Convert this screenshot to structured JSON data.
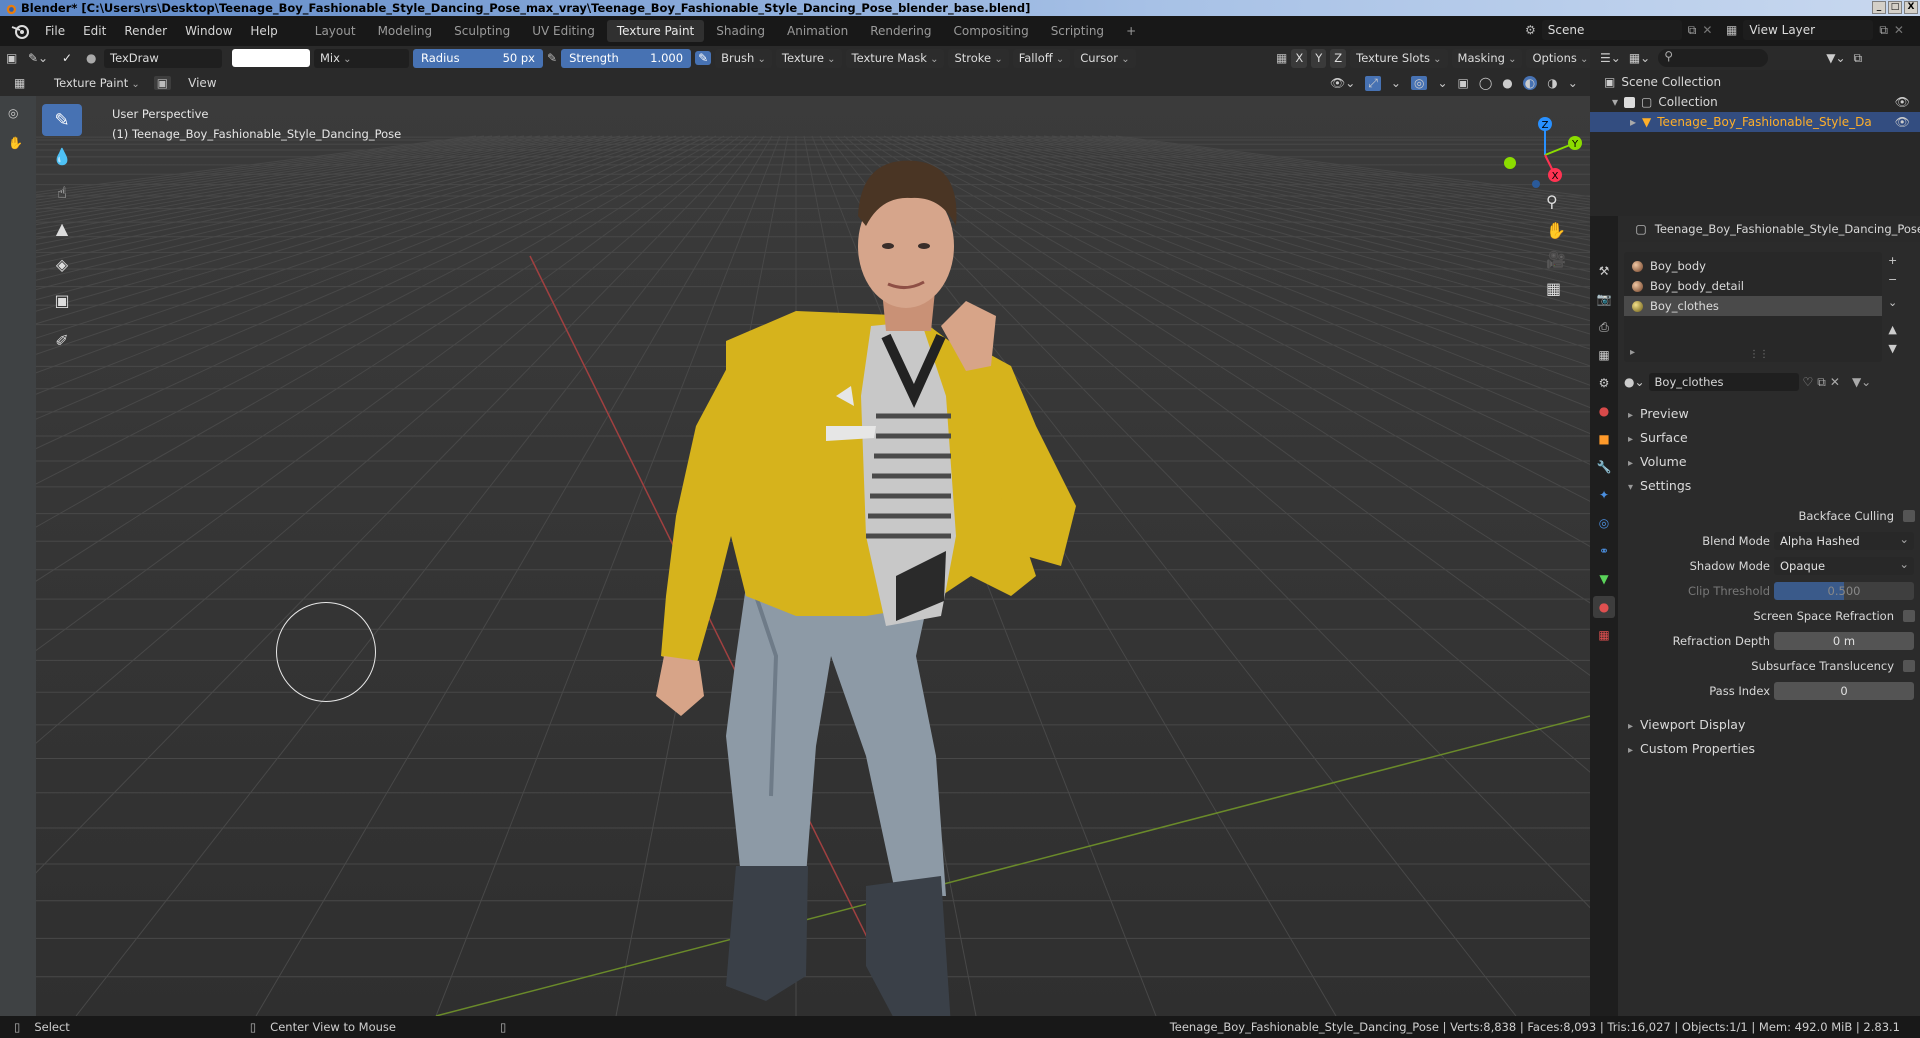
{
  "window": {
    "title": "Blender* [C:\\Users\\rs\\Desktop\\Teenage_Boy_Fashionable_Style_Dancing_Pose_max_vray\\Teenage_Boy_Fashionable_Style_Dancing_Pose_blender_base.blend]",
    "controls": [
      "_",
      "□",
      "X"
    ]
  },
  "menu": {
    "items": [
      "File",
      "Edit",
      "Render",
      "Window",
      "Help"
    ],
    "workspaces": [
      "Layout",
      "Modeling",
      "Sculpting",
      "UV Editing",
      "Texture Paint",
      "Shading",
      "Animation",
      "Rendering",
      "Compositing",
      "Scripting"
    ],
    "active_workspace": "Texture Paint",
    "add_tab": "+",
    "scene": "Scene",
    "view_layer": "View Layer"
  },
  "tool_header": {
    "brush_name": "TexDraw",
    "blend": "Mix",
    "radius_label": "Radius",
    "radius_value": "50 px",
    "strength_label": "Strength",
    "strength_value": "1.000",
    "strength_fill": 1.0,
    "dropdowns": [
      "Brush",
      "Texture",
      "Texture Mask",
      "Stroke",
      "Falloff",
      "Cursor"
    ],
    "axes": [
      "X",
      "Y",
      "Z"
    ],
    "right_dropdowns": [
      "Texture Slots",
      "Masking",
      "Options"
    ]
  },
  "header2": {
    "mode": "Texture Paint",
    "view": "View"
  },
  "viewport": {
    "perspective": "User Perspective",
    "object_label": "(1) Teenage_Boy_Fashionable_Style_Dancing_Pose",
    "gizmo_axes": [
      "Z",
      "Y",
      "X"
    ],
    "colors": {
      "x_axis": "#ff3352",
      "y_axis": "#8bdc00",
      "z_axis": "#2890ff",
      "jacket": "#d8b51a"
    }
  },
  "outliner": {
    "scene_collection": "Scene Collection",
    "collection": "Collection",
    "object": "Teenage_Boy_Fashionable_Style_Dancing_Pose"
  },
  "properties": {
    "object_name": "Teenage_Boy_Fashionable_Style_Dancing_Pose",
    "material_slots": [
      "Boy_body",
      "Boy_body_detail",
      "Boy_clothes"
    ],
    "selected_slot": "Boy_clothes",
    "material_name": "Boy_clothes",
    "sections": {
      "preview": "Preview",
      "surface": "Surface",
      "volume": "Volume",
      "settings": "Settings",
      "viewport_display": "Viewport Display",
      "custom_properties": "Custom Properties"
    },
    "settings": {
      "backface_culling": "Backface Culling",
      "blend_mode_label": "Blend Mode",
      "blend_mode": "Alpha Hashed",
      "shadow_mode_label": "Shadow Mode",
      "shadow_mode": "Opaque",
      "clip_threshold_label": "Clip Threshold",
      "clip_threshold": "0.500",
      "ssr_label": "Screen Space Refraction",
      "refraction_depth_label": "Refraction Depth",
      "refraction_depth": "0 m",
      "subsurface_label": "Subsurface Translucency",
      "pass_index_label": "Pass Index",
      "pass_index": "0"
    }
  },
  "statusbar": {
    "select": "Select",
    "center_view": "Center View to Mouse",
    "stats": "Teenage_Boy_Fashionable_Style_Dancing_Pose | Verts:8,838 | Faces:8,093 | Tris:16,027 | Objects:1/1 | Mem: 492.0 MiB | 2.83.1"
  }
}
